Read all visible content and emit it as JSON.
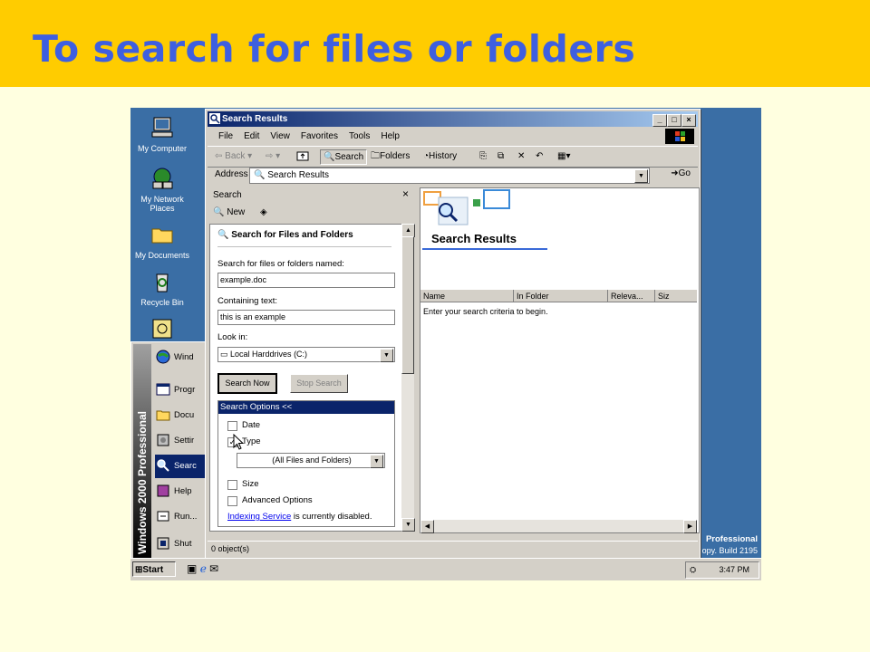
{
  "slide": {
    "title": "To search for files or folders"
  },
  "desktop": {
    "icons": [
      {
        "label": "My Computer"
      },
      {
        "label": "My Network Places"
      },
      {
        "label": "My Documents"
      },
      {
        "label": "Recycle Bin"
      }
    ],
    "watermark": {
      "line1": "Professional",
      "line2": "opy. Build 2195"
    }
  },
  "window": {
    "title": "Search Results",
    "menu": [
      "File",
      "Edit",
      "View",
      "Favorites",
      "Tools",
      "Help"
    ],
    "toolbar": {
      "back": "Back",
      "search": "Search",
      "folders": "Folders",
      "history": "History"
    },
    "address": {
      "label": "Address",
      "value": "Search Results",
      "go": "Go"
    },
    "status": "0 object(s)"
  },
  "search_pane": {
    "header": "Search",
    "new_label": "New",
    "heading": "Search for Files and Folders",
    "named_label": "Search for files or folders named:",
    "named_value": "example.doc",
    "containing_label": "Containing text:",
    "containing_value": "this is an example",
    "lookin_label": "Look in:",
    "lookin_value": "Local Harddrives (C:)",
    "search_now": "Search Now",
    "stop_search": "Stop Search",
    "options_header": "Search Options <<",
    "options": {
      "date": {
        "label": "Date",
        "checked": false
      },
      "type": {
        "label": "Type",
        "checked": true
      },
      "type_value": "(All Files and Folders)",
      "size": {
        "label": "Size",
        "checked": false
      },
      "advanced": {
        "label": "Advanced Options",
        "checked": false
      }
    },
    "indexing_link": "Indexing Service",
    "indexing_text": " is currently disabled."
  },
  "results": {
    "title": "Search Results",
    "columns": [
      "Name",
      "In Folder",
      "Releva...",
      "Siz"
    ],
    "empty_text": "Enter your search criteria to begin."
  },
  "start_menu": {
    "banner": "Windows 2000 Professional",
    "items": [
      "Wind",
      "Progr",
      "Docu",
      "Settir",
      "Searc",
      "Help",
      "Run...",
      "Shut"
    ]
  },
  "taskbar": {
    "start": "Start",
    "clock": "3:47 PM"
  }
}
